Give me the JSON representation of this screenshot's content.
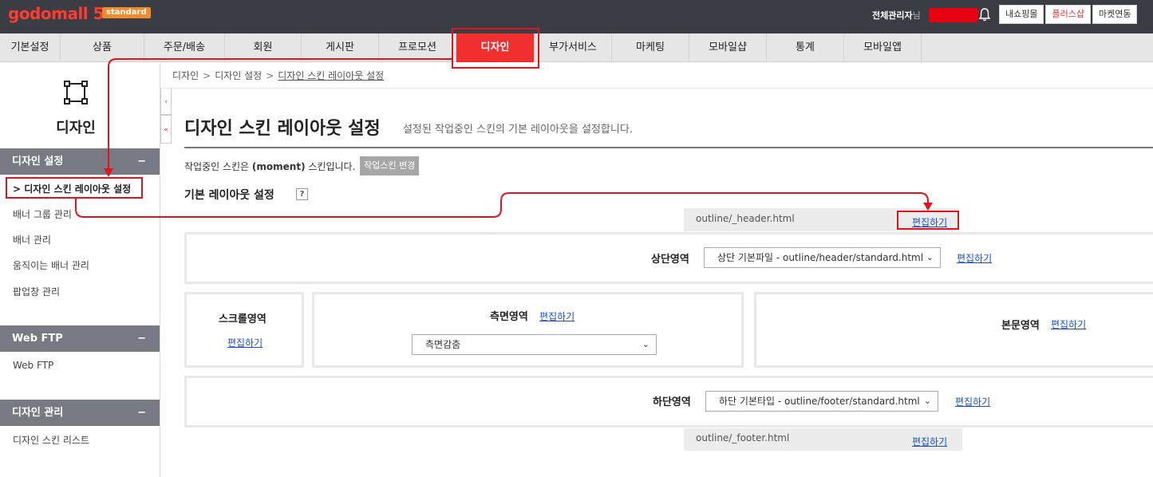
{
  "topbar": {
    "logo_text": "godomall 5",
    "logo_badge": "standard",
    "admin_label": "전체관리자",
    "admin_suffix": "님",
    "buttons": [
      "내쇼핑몰",
      "플러스샵",
      "마켓연동"
    ]
  },
  "mainnav": {
    "items": [
      "기본설정",
      "상품",
      "주문/배송",
      "회원",
      "게시판",
      "프로모션",
      "디자인",
      "부가서비스",
      "마케팅",
      "모바일샵",
      "통계",
      "모바일앱"
    ],
    "active": "디자인"
  },
  "sidebar": {
    "title": "디자인",
    "groups": [
      {
        "label": "디자인 설정",
        "toggle": "−",
        "items": [
          "> 디자인 스킨 레이아웃 설정",
          "배너 그룹 관리",
          "배너 관리",
          "움직이는 배너 관리",
          "팝업창 관리"
        ]
      },
      {
        "label": "Web FTP",
        "toggle": "−",
        "items": [
          "Web FTP"
        ]
      },
      {
        "label": "디자인 관리",
        "toggle": "−",
        "items": [
          "디자인 스킨 리스트"
        ]
      }
    ],
    "collapse_tabs": [
      "‹",
      "«"
    ]
  },
  "breadcrumb": [
    "디자인",
    "디자인 설정",
    "디자인 스킨 레이아웃 설정"
  ],
  "breadcrumb_sep": ">",
  "page": {
    "title": "디자인 스킨 레이아웃 설정",
    "description": "설정된 작업중인 스킨의 기본 레이아웃을 설정합니다.",
    "skin_info_prefix": "작업중인 스킨은 ",
    "skin_name": "(moment)",
    "skin_info_suffix": " 스킨입니다.",
    "change_skin_button": "작업스킨 변경",
    "section_title": "기본 레이아웃 설정",
    "help": "?"
  },
  "layout": {
    "header_file": "outline/_header.html",
    "footer_file": "outline/_footer.html",
    "edit_label": "편집하기",
    "top_area": {
      "label": "상단영역",
      "selected": "상단 기본파일 - outline/header/standard.html"
    },
    "scroll_area": {
      "label": "스크롤영역"
    },
    "side_area": {
      "label": "측면영역",
      "selected": "측면감춤"
    },
    "body_area": {
      "label": "본문영역"
    },
    "bottom_area": {
      "label": "하단영역",
      "selected": "하단 기본타입 - outline/footer/standard.html"
    }
  },
  "colors": {
    "accent": "#f22f2f",
    "highlight": "#e0141e",
    "link": "#1a4ec6",
    "topbar": "#3b3d45",
    "sidebar_head": "#777a82"
  }
}
